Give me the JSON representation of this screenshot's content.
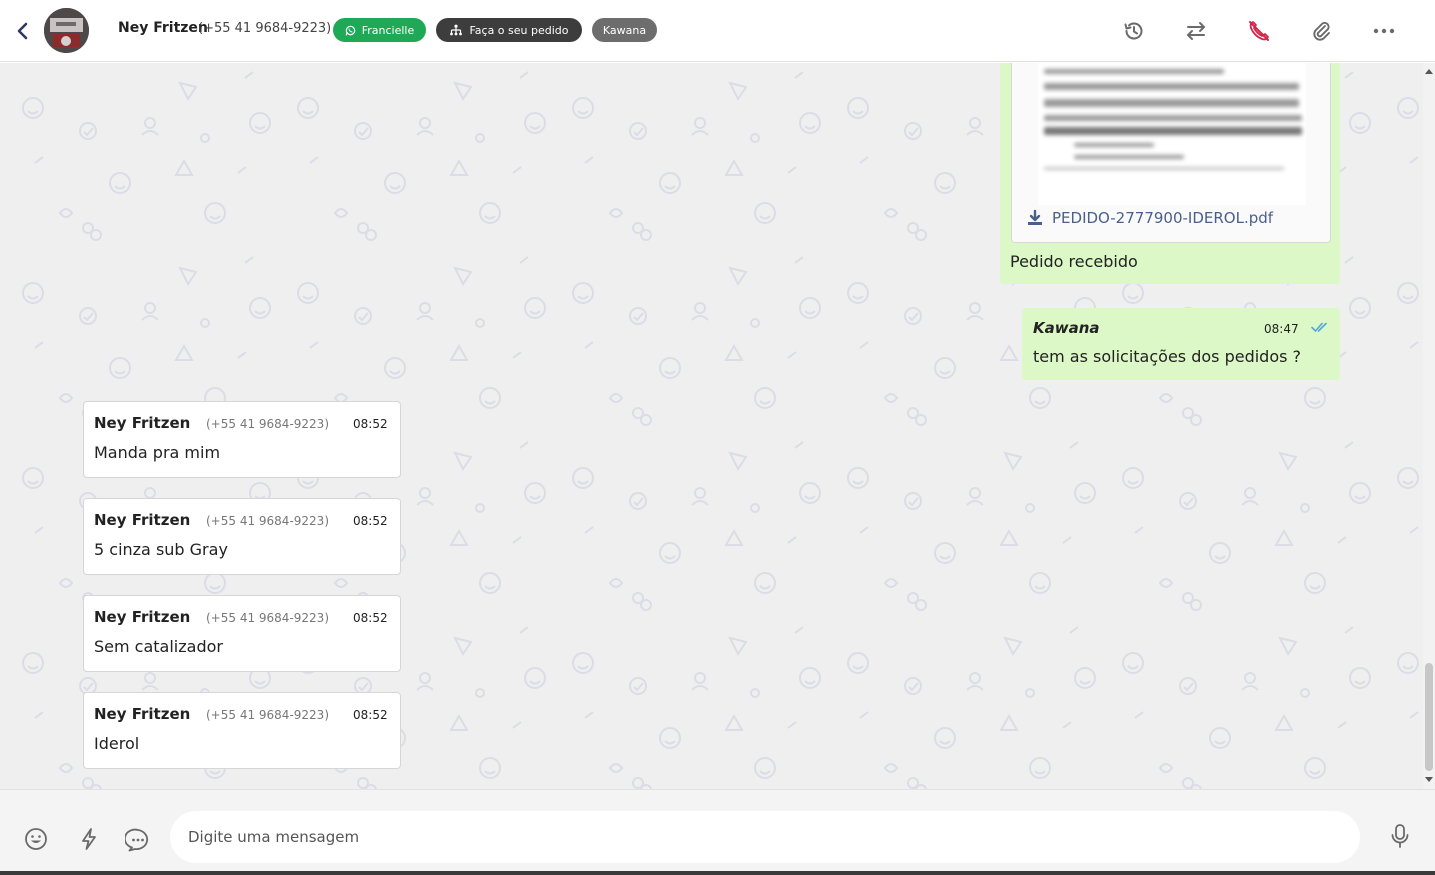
{
  "header": {
    "contact_name": "Ney Fritzen",
    "contact_phone": "(+55 41 9684-9223)",
    "tags": {
      "whatsapp": "Francielle",
      "order": "Faça o seu pedido",
      "agent": "Kawana"
    },
    "icons": [
      "history-icon",
      "transfer-icon",
      "phone-off-icon",
      "attachment-icon",
      "more-icon"
    ],
    "accent_color": "#1fa855"
  },
  "messages": {
    "document": {
      "file_name": "PEDIDO-2777900-IDEROL.pdf",
      "caption": "Pedido recebido"
    },
    "outgoing": {
      "author": "Kawana",
      "time": "08:47",
      "text": "tem as solicitações dos pedidos ?"
    },
    "incoming": [
      {
        "name": "Ney Fritzen",
        "phone": "(+55 41 9684-9223)",
        "time": "08:52",
        "text": "Manda pra mim"
      },
      {
        "name": "Ney Fritzen",
        "phone": "(+55 41 9684-9223)",
        "time": "08:52",
        "text": "5 cinza sub Gray"
      },
      {
        "name": "Ney Fritzen",
        "phone": "(+55 41 9684-9223)",
        "time": "08:52",
        "text": "Sem catalizador"
      },
      {
        "name": "Ney Fritzen",
        "phone": "(+55 41 9684-9223)",
        "time": "08:52",
        "text": "Iderol"
      }
    ]
  },
  "composer": {
    "placeholder": "Digite uma mensagem",
    "value": ""
  }
}
